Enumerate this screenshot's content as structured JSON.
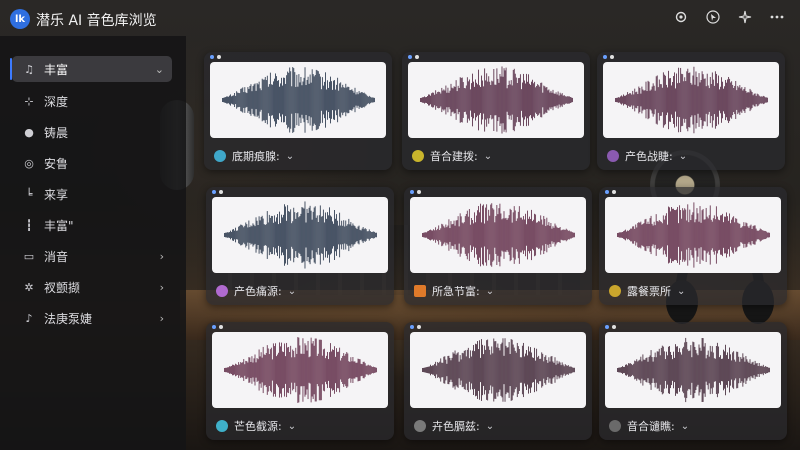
{
  "app": {
    "logo_text": "lk",
    "title": "潜乐 AI 音色库浏览"
  },
  "titlebar_icons": [
    "gear-icon",
    "cursor-icon",
    "sparkle-icon",
    "more-icon"
  ],
  "sidebar": {
    "items": [
      {
        "label": "丰富",
        "icon": "piano-icon",
        "active": true,
        "chevron": "⌄"
      },
      {
        "label": "深度",
        "icon": "waveform-icon",
        "active": false,
        "chevron": ""
      },
      {
        "label": "铸晨",
        "icon": "user-icon",
        "active": false,
        "chevron": ""
      },
      {
        "label": "安鲁",
        "icon": "target-icon",
        "active": false,
        "chevron": ""
      },
      {
        "label": "来享",
        "icon": "chart-icon",
        "active": false,
        "chevron": ""
      },
      {
        "label": "丰富\"",
        "icon": "bars-icon",
        "active": false,
        "chevron": ""
      },
      {
        "label": "消音",
        "icon": "layers-icon",
        "active": false,
        "chevron": "›"
      },
      {
        "label": "衩颤撷",
        "icon": "gear-small-icon",
        "active": false,
        "chevron": "›"
      },
      {
        "label": "法庚泵婕",
        "icon": "mic-icon",
        "active": false,
        "chevron": "›"
      }
    ]
  },
  "cards": [
    {
      "label": "底期痕腺:",
      "badge_color": "#3fa7c9",
      "wave_color": "#1f2d42",
      "badge_shape": "circle"
    },
    {
      "label": "音合建拨:",
      "badge_color": "#c9b52c",
      "wave_color": "#4a1f3a",
      "badge_shape": "circle"
    },
    {
      "label": "产色战睫:",
      "badge_color": "#8a5ab0",
      "wave_color": "#4a1f3a",
      "badge_shape": "circle"
    },
    {
      "label": "产色痛源:",
      "badge_color": "#b06ad0",
      "wave_color": "#1f2d42",
      "badge_shape": "circle"
    },
    {
      "label": "所急节富:",
      "badge_color": "#e07a2a",
      "wave_color": "#5a2440",
      "badge_shape": "square"
    },
    {
      "label": "露餐票所",
      "badge_color": "#c9a52c",
      "wave_color": "#5a2440",
      "badge_shape": "circle"
    },
    {
      "label": "芒色截源:",
      "badge_color": "#3fb0c9",
      "wave_color": "#5a2440",
      "badge_shape": "circle"
    },
    {
      "label": "卉色膈兹:",
      "badge_color": "#7a7a7a",
      "wave_color": "#3a1f30",
      "badge_shape": "circle"
    },
    {
      "label": "音合谴瞧:",
      "badge_color": "#6a6a6a",
      "wave_color": "#3a1f30",
      "badge_shape": "circle"
    }
  ],
  "card_chevron": "⌄"
}
